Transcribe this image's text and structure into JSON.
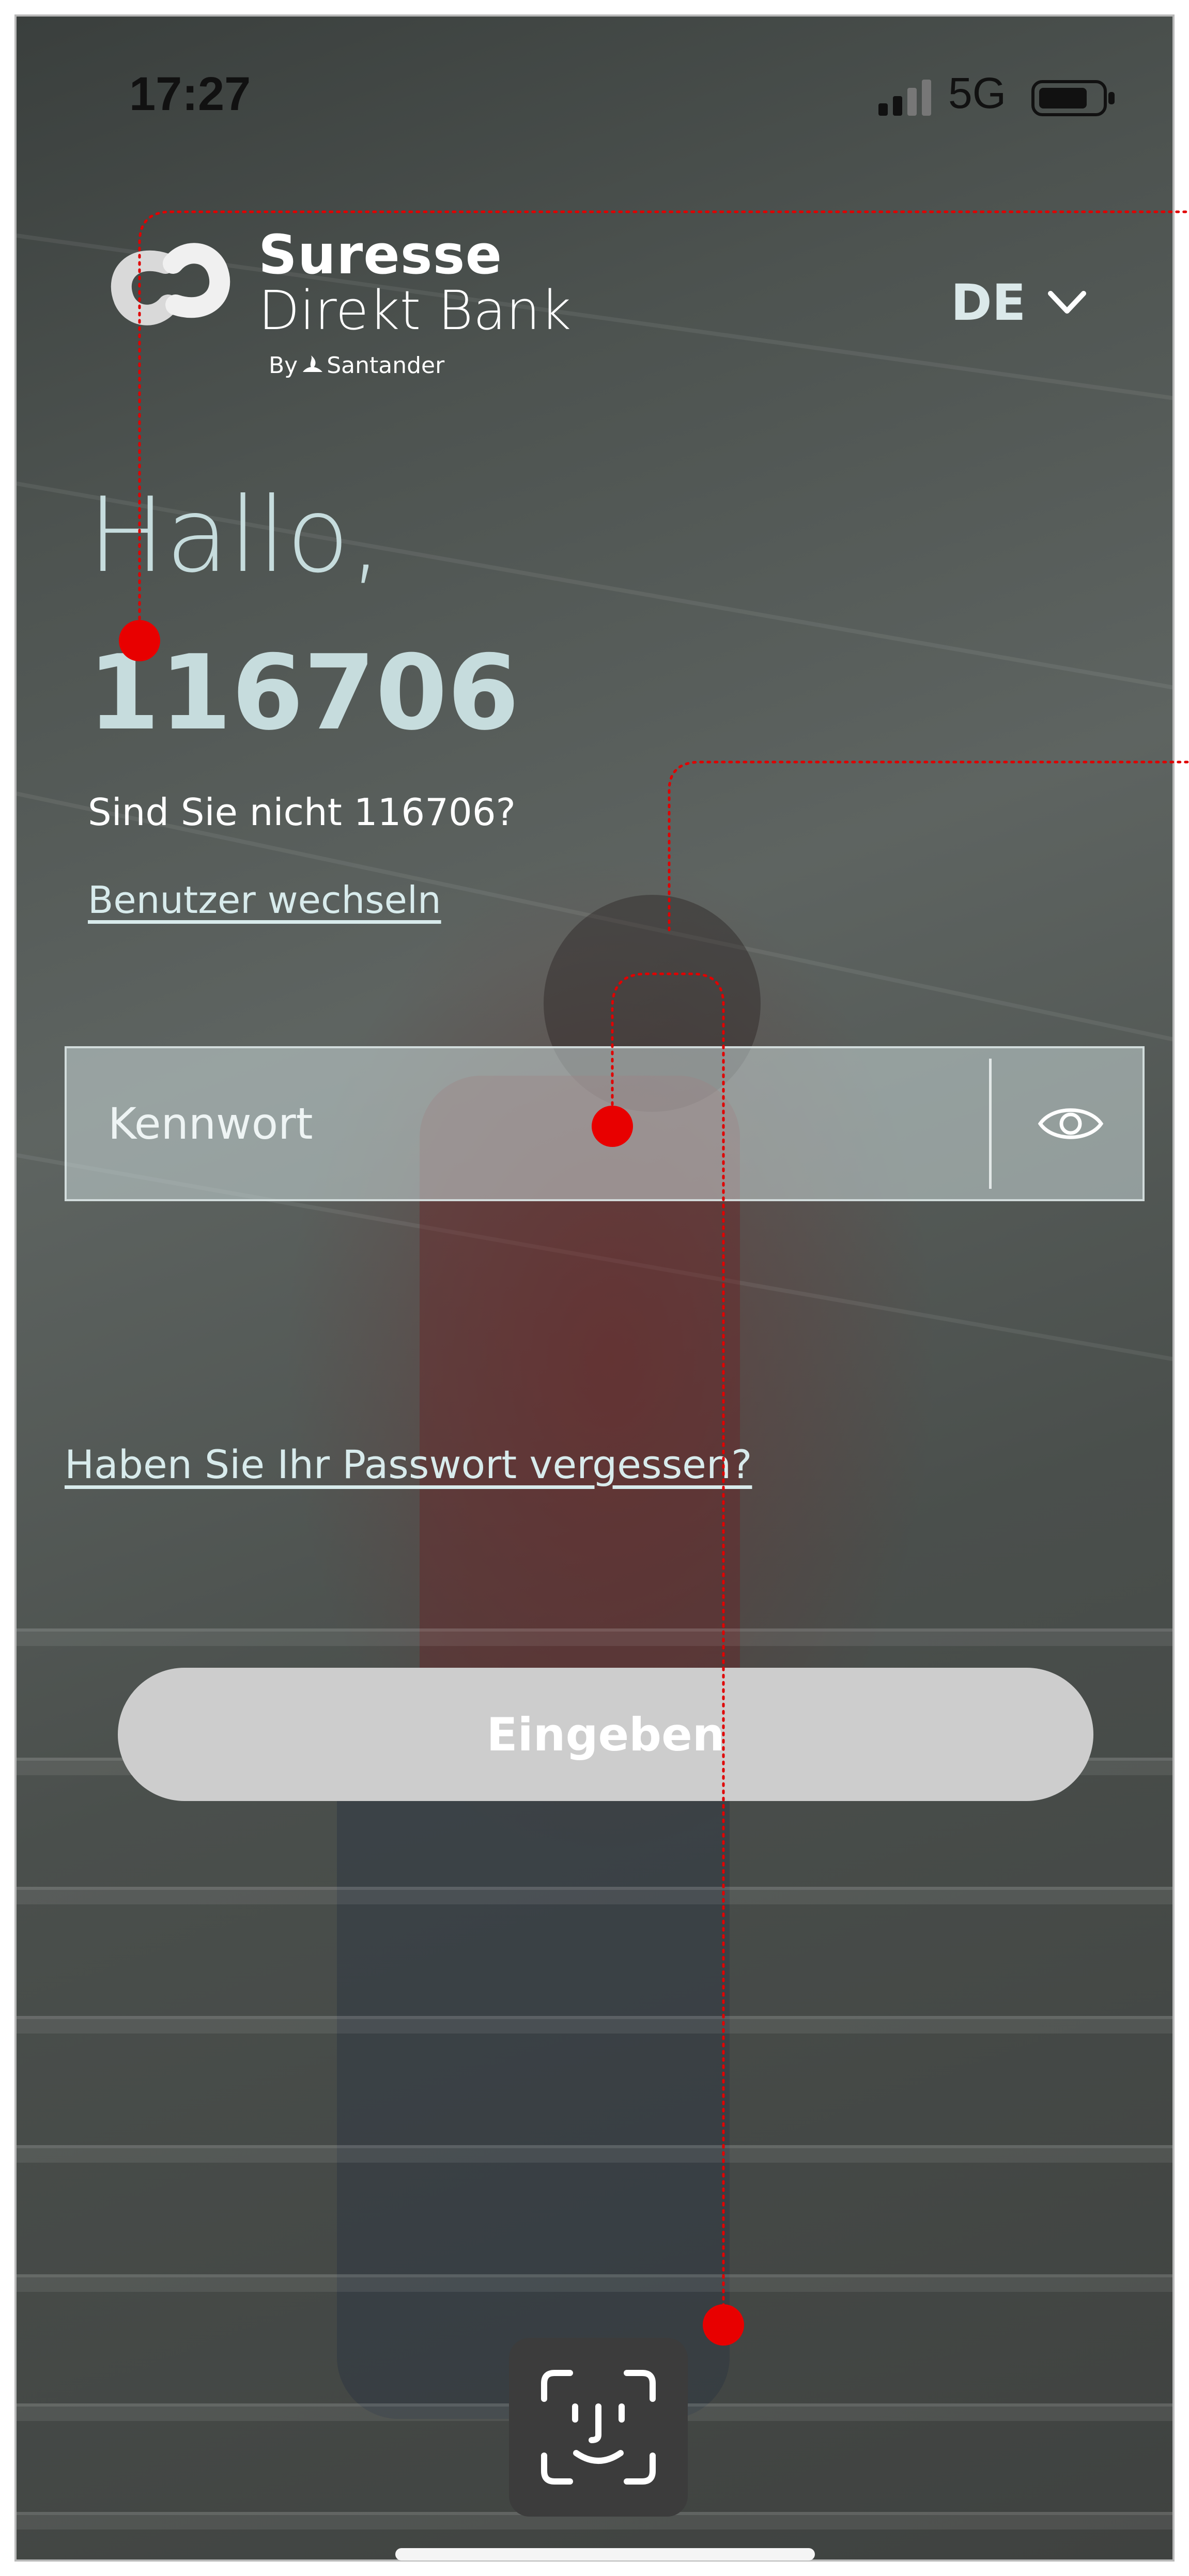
{
  "status_bar": {
    "time": "17:27",
    "network": "5G"
  },
  "brand": {
    "line1": "Suresse",
    "line2": "Direkt Bank",
    "by": "By",
    "partner": "Santander"
  },
  "language": {
    "selected": "DE",
    "icon": "chevron-down-icon"
  },
  "greeting": {
    "hello": "Hallo,",
    "user_id": "116706",
    "not_you": "Sind Sie nicht 116706?",
    "switch_user": "Benutzer wechseln"
  },
  "password_field": {
    "placeholder": "Kennwort",
    "value": "",
    "toggle_icon": "eye-icon"
  },
  "forgot_password": "Haben Sie Ihr Passwort vergessen?",
  "submit_label": "Eingeben",
  "face_id_icon": "face-id-icon",
  "colors": {
    "accent_text": "#c6dcdd",
    "button_bg": "#cdcdcd",
    "annotation_red": "#e00000"
  }
}
